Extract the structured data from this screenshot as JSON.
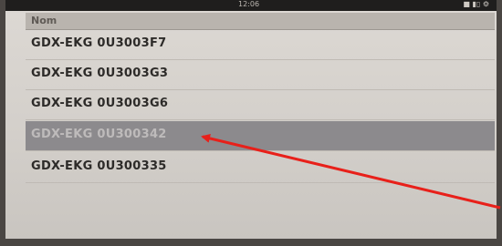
{
  "status_bar": {
    "time": "12:06",
    "icons": "■ ▮▯ ⚙"
  },
  "list": {
    "header": "Nom",
    "items": [
      {
        "label": "GDX-EKG 0U3003F7",
        "selected": false
      },
      {
        "label": "GDX-EKG 0U3003G3",
        "selected": false
      },
      {
        "label": "GDX-EKG 0U3003G6",
        "selected": false
      },
      {
        "label": "GDX-EKG 0U300342",
        "selected": true
      },
      {
        "label": "GDX-EKG 0U300335",
        "selected": false
      }
    ]
  },
  "annotation": {
    "arrow_color": "#e8201a"
  },
  "colors": {
    "selected_row_bg": "#8c8a8d",
    "list_bg": "#d8d4cf"
  }
}
